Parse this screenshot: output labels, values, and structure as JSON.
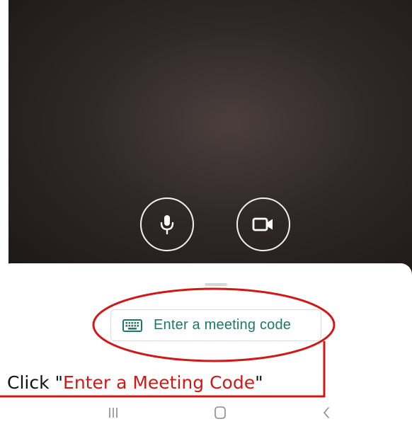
{
  "camera": {
    "mic_icon": "microphone-icon",
    "camera_icon": "video-camera-icon"
  },
  "meeting_code_button": {
    "label": "Enter a meeting code",
    "icon": "keyboard-icon",
    "text_color": "#1a7a62"
  },
  "instruction": {
    "prefix": "Click \"",
    "highlight": "Enter a Meeting Code",
    "suffix": "\"",
    "highlight_color": "#d01818"
  },
  "annotation": {
    "color": "#d01818"
  },
  "nav_bar": {
    "recents_icon": "recents-icon",
    "home_icon": "home-icon",
    "back_icon": "back-icon"
  }
}
